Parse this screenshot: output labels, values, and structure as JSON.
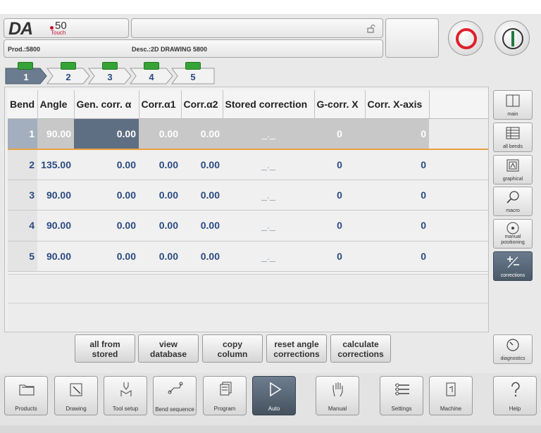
{
  "header": {
    "logo_text": "DA",
    "logo_number": "50",
    "logo_sub": "Touch",
    "product": "Prod.:5800",
    "description": "Desc.:2D DRAWING 5800"
  },
  "tabs": [
    {
      "label": "1",
      "active": true
    },
    {
      "label": "2",
      "active": false
    },
    {
      "label": "3",
      "active": false
    },
    {
      "label": "4",
      "active": false
    },
    {
      "label": "5",
      "active": false
    }
  ],
  "table": {
    "headers": [
      "Bend",
      "Angle",
      "Gen. corr. α",
      "Corr.α1",
      "Corr.α2",
      "Stored correction",
      "G-corr. X",
      "Corr. X-axis"
    ],
    "rows": [
      [
        "1",
        "90.00",
        "0.00",
        "0.00",
        "0.00",
        "_._",
        "0",
        "0"
      ],
      [
        "2",
        "135.00",
        "0.00",
        "0.00",
        "0.00",
        "_._",
        "0",
        "0"
      ],
      [
        "3",
        "90.00",
        "0.00",
        "0.00",
        "0.00",
        "_._",
        "0",
        "0"
      ],
      [
        "4",
        "90.00",
        "0.00",
        "0.00",
        "0.00",
        "_._",
        "0",
        "0"
      ],
      [
        "5",
        "90.00",
        "0.00",
        "0.00",
        "0.00",
        "_._",
        "0",
        "0"
      ]
    ]
  },
  "side_buttons": [
    {
      "label": "main",
      "icon": "main-icon"
    },
    {
      "label": "all bends",
      "icon": "table-icon"
    },
    {
      "label": "graphical",
      "icon": "graphical-icon"
    },
    {
      "label": "macro",
      "icon": "magnifier-icon"
    },
    {
      "label": "manual positioning",
      "icon": "positioning-icon"
    },
    {
      "label": "corrections",
      "icon": "plus-minus-icon"
    },
    {
      "label": "diagnostics",
      "icon": "gauge-icon"
    }
  ],
  "actions": [
    {
      "line1": "all from",
      "line2": "stored"
    },
    {
      "line1": "view",
      "line2": "database"
    },
    {
      "line1": "copy",
      "line2": "column"
    },
    {
      "line1": "reset angle",
      "line2": "corrections"
    },
    {
      "line1": "calculate",
      "line2": "corrections"
    }
  ],
  "nav": [
    {
      "label": "Products",
      "icon": "folder-icon"
    },
    {
      "label": "Drawing",
      "icon": "pencil-icon"
    },
    {
      "label": "Tool setup",
      "icon": "tool-icon"
    },
    {
      "label": "Bend sequence",
      "icon": "bend-sequence-icon"
    },
    {
      "label": "Program",
      "icon": "program-icon"
    },
    {
      "label": "Auto",
      "icon": "play-icon"
    },
    {
      "label": "Manual",
      "icon": "hand-icon"
    },
    {
      "label": "Settings",
      "icon": "settings-icon"
    },
    {
      "label": "Machine",
      "icon": "machine-icon"
    },
    {
      "label": "Help",
      "icon": "help-icon"
    }
  ],
  "colors": {
    "accent": "#2b4a82",
    "selected_cell": "#5f6f83",
    "stop": "#e0202a",
    "start": "#1e7a3e",
    "tab_badge": "#36a336"
  }
}
